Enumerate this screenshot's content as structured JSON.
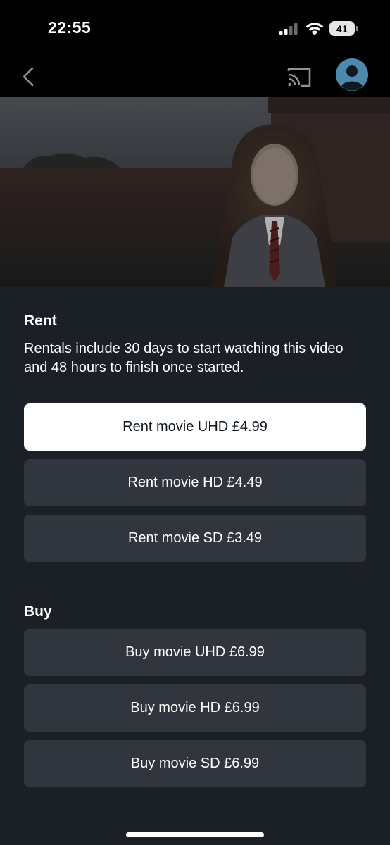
{
  "status_bar": {
    "time": "22:55",
    "battery": "41",
    "icons": [
      "signal-icon",
      "wifi-icon",
      "battery-icon"
    ]
  },
  "nav": {
    "icons": [
      "back-icon",
      "cast-icon",
      "profile-avatar-icon"
    ]
  },
  "rent": {
    "title": "Rent",
    "description": "Rentals include 30 days to start watching this video and 48 hours to finish once started.",
    "options": [
      {
        "label": "Rent movie UHD £4.99",
        "selected": true
      },
      {
        "label": "Rent movie HD £4.49",
        "selected": false
      },
      {
        "label": "Rent movie SD £3.49",
        "selected": false
      }
    ]
  },
  "buy": {
    "title": "Buy",
    "options": [
      {
        "label": "Buy movie UHD £6.99",
        "selected": false
      },
      {
        "label": "Buy movie HD £6.99",
        "selected": false
      },
      {
        "label": "Buy movie SD £6.99",
        "selected": false
      }
    ]
  },
  "colors": {
    "background": "#1b1f26",
    "option_background": "#31353d",
    "selected_background": "#ffffff",
    "selected_text": "#0f171e"
  }
}
